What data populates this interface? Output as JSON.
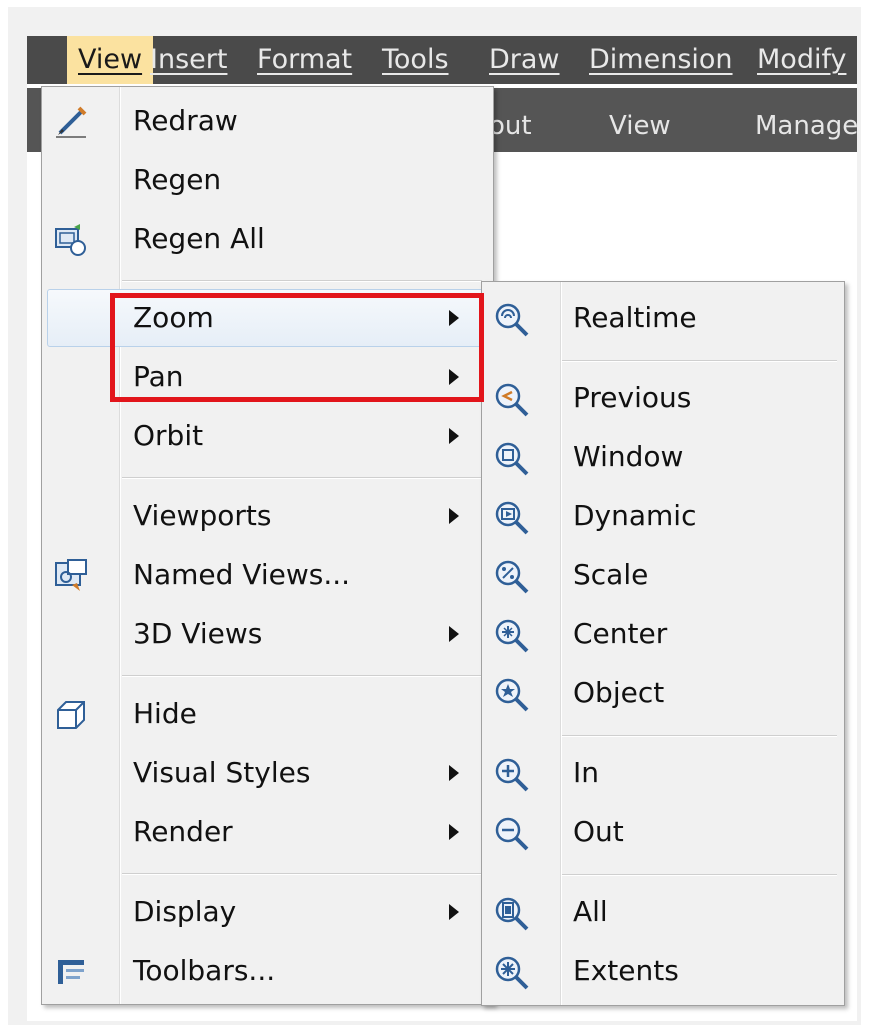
{
  "menubar": {
    "items": [
      "View",
      "Insert",
      "Format",
      "Tools",
      "Draw",
      "Dimension",
      "Modify"
    ]
  },
  "ribbon": {
    "tabs": [
      "out",
      "View",
      "Manage"
    ]
  },
  "view_menu": {
    "items": [
      {
        "label": "Redraw",
        "icon": "pencil-icon"
      },
      {
        "label": "Regen"
      },
      {
        "label": "Regen All",
        "icon": "regen-all-icon"
      },
      {
        "label": "Zoom",
        "submenu": true
      },
      {
        "label": "Pan",
        "submenu": true
      },
      {
        "label": "Orbit",
        "submenu": true
      },
      {
        "label": "Viewports",
        "submenu": true
      },
      {
        "label": "Named Views...",
        "icon": "named-views-icon"
      },
      {
        "label": "3D Views",
        "submenu": true
      },
      {
        "label": "Hide",
        "icon": "cube-icon"
      },
      {
        "label": "Visual Styles",
        "submenu": true
      },
      {
        "label": "Render",
        "submenu": true
      },
      {
        "label": "Display",
        "submenu": true
      },
      {
        "label": "Toolbars...",
        "icon": "toolbars-icon"
      }
    ]
  },
  "zoom_submenu": {
    "items": [
      {
        "label": "Realtime",
        "icon": "zoom-realtime-icon"
      },
      {
        "label": "Previous",
        "icon": "zoom-previous-icon"
      },
      {
        "label": "Window",
        "icon": "zoom-window-icon"
      },
      {
        "label": "Dynamic",
        "icon": "zoom-dynamic-icon"
      },
      {
        "label": "Scale",
        "icon": "zoom-scale-icon"
      },
      {
        "label": "Center",
        "icon": "zoom-center-icon"
      },
      {
        "label": "Object",
        "icon": "zoom-object-icon"
      },
      {
        "label": "In",
        "icon": "zoom-in-icon"
      },
      {
        "label": "Out",
        "icon": "zoom-out-icon"
      },
      {
        "label": "All",
        "icon": "zoom-all-icon"
      },
      {
        "label": "Extents",
        "icon": "zoom-extents-icon"
      }
    ]
  },
  "colors": {
    "highlight_border": "#e2151b",
    "active_menu_bg": "#fbe2a0",
    "menu_bg": "#f1f1f1",
    "icon_blue": "#2f5f97"
  }
}
